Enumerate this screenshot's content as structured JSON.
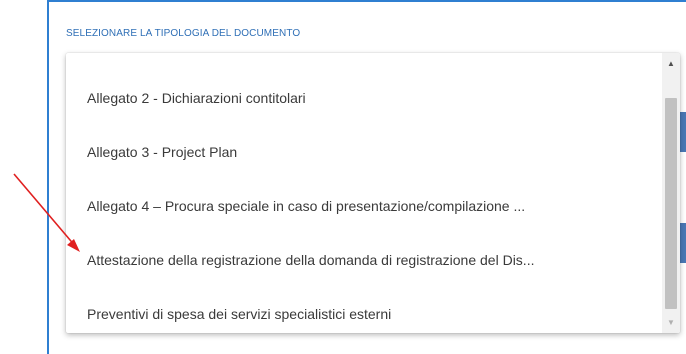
{
  "field": {
    "label": "SELEZIONARE LA TIPOLOGIA DEL DOCUMENTO"
  },
  "dropdown": {
    "options": [
      "Allegato 2 - Dichiarazioni contitolari",
      "Allegato 3 - Project Plan",
      "Allegato 4 – Procura speciale in caso di presentazione/compilazione ...",
      "Attestazione della registrazione della domanda di registrazione del Dis...",
      "Preventivi di spesa dei servizi specialistici esterni"
    ]
  },
  "icons": {
    "scroll_up": "chevron-up-icon",
    "scroll_down": "chevron-down-icon",
    "annotation": "red-arrow-icon"
  },
  "colors": {
    "accent": "#2f7fd1",
    "label": "#2f6fb6",
    "annotation_arrow": "#e02020"
  }
}
